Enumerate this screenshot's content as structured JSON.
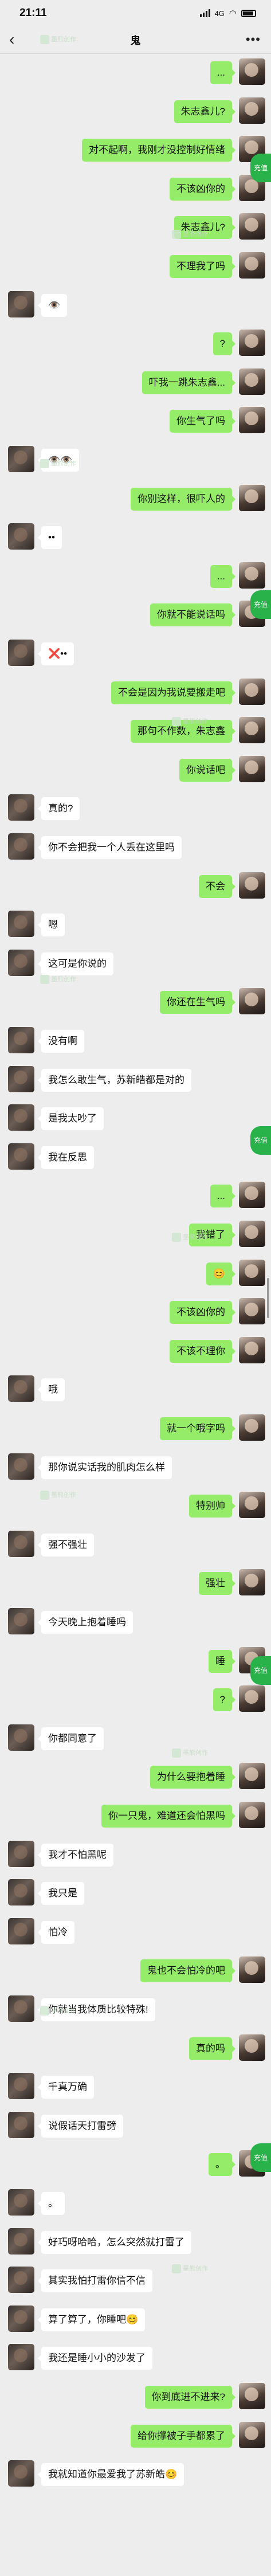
{
  "status": {
    "time": "21:11",
    "network": "4G"
  },
  "header": {
    "title": "鬼",
    "back_icon": "chevron-left-icon",
    "more_icon": "more-dots-icon"
  },
  "watermark": "墨熊创作",
  "badge_label": "充值",
  "messages": [
    {
      "side": "right",
      "text": "..."
    },
    {
      "side": "right",
      "text": "朱志鑫儿?"
    },
    {
      "side": "right",
      "text": "对不起啊，我刚才没控制好情绪"
    },
    {
      "side": "right",
      "text": "不该凶你的"
    },
    {
      "side": "right",
      "text": "朱志鑫儿?"
    },
    {
      "side": "right",
      "text": "不理我了吗"
    },
    {
      "side": "left",
      "text": "👁️"
    },
    {
      "side": "right",
      "text": "?"
    },
    {
      "side": "right",
      "text": "吓我一跳朱志鑫..."
    },
    {
      "side": "right",
      "text": "你生气了吗"
    },
    {
      "side": "left",
      "text": "👁️👁️"
    },
    {
      "side": "right",
      "text": "你别这样，很吓人的"
    },
    {
      "side": "left",
      "text": "••"
    },
    {
      "side": "right",
      "text": "..."
    },
    {
      "side": "right",
      "text": "你就不能说话吗"
    },
    {
      "side": "left",
      "text": "❌••"
    },
    {
      "side": "right",
      "text": "不会是因为我说要搬走吧"
    },
    {
      "side": "right",
      "text": "那句不作数，朱志鑫"
    },
    {
      "side": "right",
      "text": "你说话吧"
    },
    {
      "side": "left",
      "text": "真的?"
    },
    {
      "side": "left",
      "text": "你不会把我一个人丢在这里吗"
    },
    {
      "side": "right",
      "text": "不会"
    },
    {
      "side": "left",
      "text": "嗯"
    },
    {
      "side": "left",
      "text": "这可是你说的"
    },
    {
      "side": "right",
      "text": "你还在生气吗"
    },
    {
      "side": "left",
      "text": "没有啊"
    },
    {
      "side": "left",
      "text": "我怎么敢生气，苏新皓都是对的"
    },
    {
      "side": "left",
      "text": "是我太吵了"
    },
    {
      "side": "left",
      "text": "我在反思"
    },
    {
      "side": "right",
      "text": "..."
    },
    {
      "side": "right",
      "text": "我错了"
    },
    {
      "side": "right",
      "text": "😊"
    },
    {
      "side": "right",
      "text": "不该凶你的"
    },
    {
      "side": "right",
      "text": "不该不理你"
    },
    {
      "side": "left",
      "text": "哦"
    },
    {
      "side": "right",
      "text": "就一个哦字吗"
    },
    {
      "side": "left",
      "text": "那你说实话我的肌肉怎么样"
    },
    {
      "side": "right",
      "text": "特别帅"
    },
    {
      "side": "left",
      "text": "强不强壮"
    },
    {
      "side": "right",
      "text": "强壮"
    },
    {
      "side": "left",
      "text": "今天晚上抱着睡吗"
    },
    {
      "side": "right",
      "text": "睡"
    },
    {
      "side": "right",
      "text": "?"
    },
    {
      "side": "left",
      "text": "你都同意了"
    },
    {
      "side": "right",
      "text": "为什么要抱着睡"
    },
    {
      "side": "right",
      "text": "你一只鬼，难道还会怕黑吗"
    },
    {
      "side": "left",
      "text": "我才不怕黑呢"
    },
    {
      "side": "left",
      "text": "我只是"
    },
    {
      "side": "left",
      "text": "怕冷"
    },
    {
      "side": "right",
      "text": "鬼也不会怕冷的吧"
    },
    {
      "side": "left",
      "text": "你就当我体质比较特殊!"
    },
    {
      "side": "right",
      "text": "真的吗"
    },
    {
      "side": "left",
      "text": "千真万确"
    },
    {
      "side": "left",
      "text": "说假话天打雷劈"
    },
    {
      "side": "right",
      "text": "。"
    },
    {
      "side": "left",
      "text": "。"
    },
    {
      "side": "left",
      "text": "好巧呀哈哈，怎么突然就打雷了"
    },
    {
      "side": "left",
      "text": "其实我怕打雷你信不信"
    },
    {
      "side": "left",
      "text": "算了算了，你睡吧😊"
    },
    {
      "side": "left",
      "text": "我还是睡小小的沙发了"
    },
    {
      "side": "right",
      "text": "你到底进不进来?"
    },
    {
      "side": "right",
      "text": "给你撑被子手都累了"
    },
    {
      "side": "left",
      "text": "我就知道你最爱我了苏新皓😊"
    }
  ]
}
